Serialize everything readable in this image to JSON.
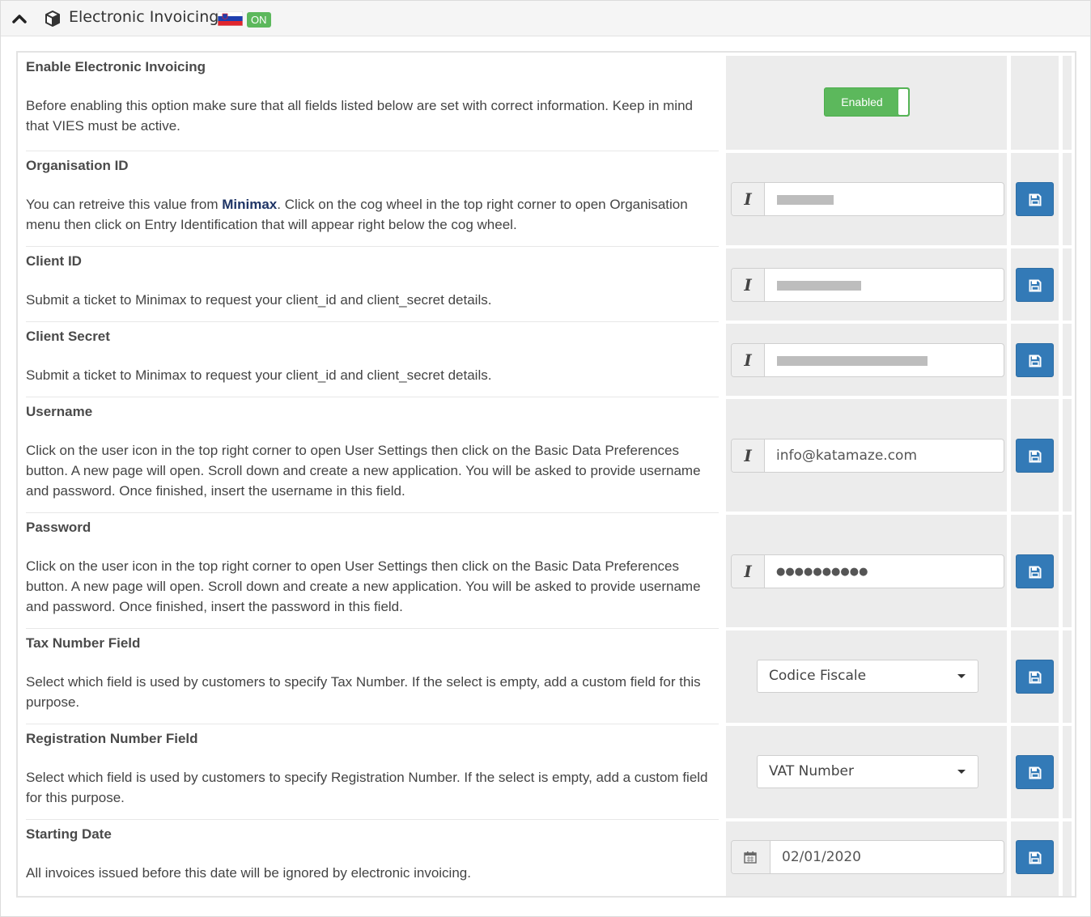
{
  "header": {
    "title": "Electronic Invoicing",
    "collapse_icon": "chevron-up-icon",
    "module_icon": "cube-icon",
    "flag_icon": "slovenia-flag-icon",
    "status_badge": "ON"
  },
  "rows": [
    {
      "label": "Enable Electronic Invoicing",
      "text": "Before enabling this option make sure that all fields listed below are set with correct information. Keep in mind that VIES must be active.",
      "toggle_label": "Enabled",
      "toggle_state": true
    },
    {
      "label": "Organisation ID",
      "text_before": "You can retreive this value from ",
      "text_link": "Minimax",
      "text_after": ". Click on the cog wheel in the top right corner to open Organisation menu then click on Entry Identification that will appear right below the cog wheel.",
      "value": "",
      "masked": true
    },
    {
      "label": "Client ID",
      "text": "Submit a ticket to Minimax to request your client_id and client_secret details.",
      "value": "",
      "masked": true
    },
    {
      "label": "Client Secret",
      "text": "Submit a ticket to Minimax to request your client_id and client_secret details.",
      "value": "",
      "masked": true
    },
    {
      "label": "Username",
      "text": "Click on the user icon in the top right corner to open User Settings then click on the Basic Data Preferences button. A new page will open. Scroll down and create a new application. You will be asked to provide username and password. Once finished, insert the username in this field.",
      "value": "info@katamaze.com"
    },
    {
      "label": "Password",
      "text": "Click on the user icon in the top right corner to open User Settings then click on the Basic Data Preferences button. A new page will open. Scroll down and create a new application. You will be asked to provide username and password. Once finished, insert the password in this field.",
      "value": "●●●●●●●●●●"
    },
    {
      "label": "Tax Number Field",
      "text": "Select which field is used by customers to specify Tax Number. If the select is empty, add a custom field for this purpose.",
      "selected": "Codice Fiscale"
    },
    {
      "label": "Registration Number Field",
      "text": "Select which field is used by customers to specify Registration Number. If the select is empty, add a custom field for this purpose.",
      "selected": "VAT Number"
    },
    {
      "label": "Starting Date",
      "text": "All invoices issued before this date will be ignored by electronic invoicing.",
      "value": "02/01/2020"
    }
  ],
  "colors": {
    "primary": "#337ab7",
    "success": "#5cb85c",
    "brand_link": "#1f3566",
    "cell_bg": "#ececec"
  },
  "icons": {
    "text_field": "text-cursor-icon",
    "date_field": "calendar-icon",
    "save": "floppy-disk-icon",
    "select": "caret-down-icon"
  }
}
